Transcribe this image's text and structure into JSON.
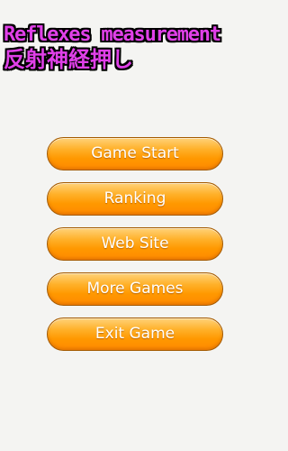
{
  "title": {
    "english": "Reflexes measurement",
    "japanese": "反射神経押し",
    "color": "#e040e8"
  },
  "menu": {
    "buttons": [
      {
        "label": "Game Start"
      },
      {
        "label": "Ranking"
      },
      {
        "label": "Web Site"
      },
      {
        "label": "More Games"
      },
      {
        "label": "Exit Game"
      }
    ],
    "accent": "#ff9800"
  }
}
